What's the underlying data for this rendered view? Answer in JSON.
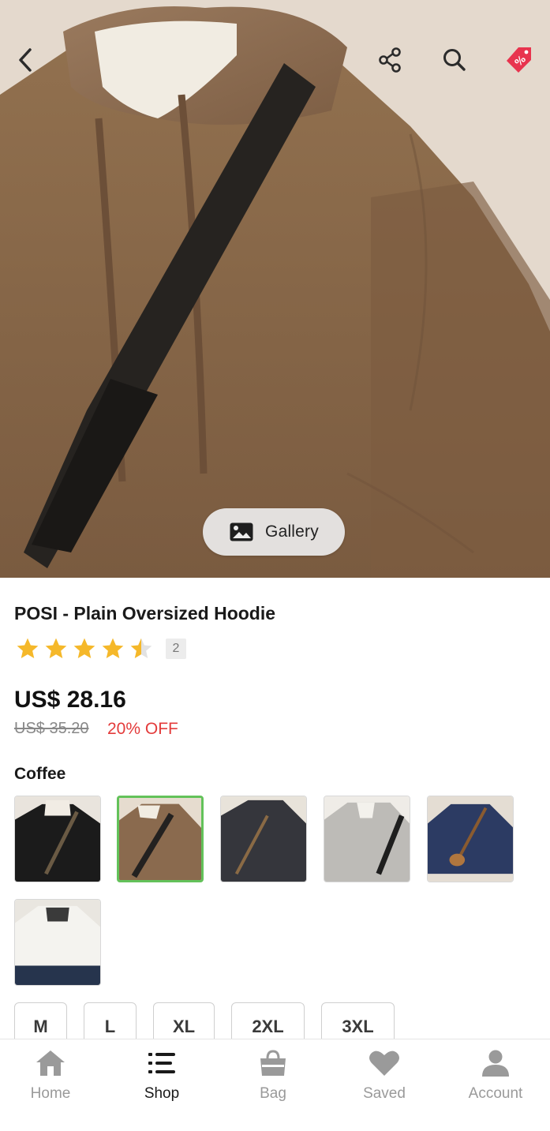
{
  "header": {
    "icons": [
      "back-arrow-icon",
      "share-icon",
      "search-icon",
      "promo-tag-icon"
    ],
    "accent": "#e8344e"
  },
  "gallery_button": {
    "label": "Gallery",
    "icon": "image-icon"
  },
  "product": {
    "title": "POSI - Plain Oversized Hoodie",
    "rating": 4.5,
    "rating_max": 5,
    "review_count": "2",
    "price": "US$ 28.16",
    "original_price": "US$ 35.20",
    "discount": "20% OFF",
    "selected_color": "Coffee",
    "colors": [
      "Black",
      "Coffee",
      "Dark Grey",
      "Light Grey",
      "Navy",
      "White"
    ],
    "sizes": [
      "M",
      "L",
      "XL",
      "2XL",
      "3XL"
    ]
  },
  "colors": {
    "star": "#f5b82a",
    "discount": "#e33b3b",
    "selected_border": "#63c25a"
  },
  "bottom_nav": {
    "items": [
      {
        "label": "Home",
        "icon": "home-icon"
      },
      {
        "label": "Shop",
        "icon": "list-icon"
      },
      {
        "label": "Bag",
        "icon": "bag-icon"
      },
      {
        "label": "Saved",
        "icon": "heart-icon"
      },
      {
        "label": "Account",
        "icon": "person-icon"
      }
    ],
    "active": "Shop"
  }
}
